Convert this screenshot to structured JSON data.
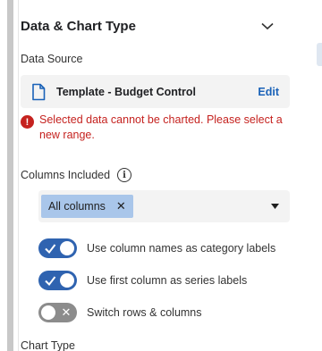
{
  "section": {
    "title": "Data & Chart Type",
    "collapse_icon": "chevron-up-icon"
  },
  "data_source": {
    "label": "Data Source",
    "icon": "document-icon",
    "name": "Template - Budget Control",
    "edit_label": "Edit"
  },
  "error": {
    "icon": "error-icon",
    "message": "Selected data cannot be charted. Please select a new range."
  },
  "columns": {
    "label": "Columns Included",
    "info_icon": "info-icon",
    "selected_chip": "All columns",
    "remove_icon": "close-icon",
    "dropdown_icon": "caret-down-icon"
  },
  "toggles": [
    {
      "label": "Use column names as category labels",
      "on": true
    },
    {
      "label": "Use first column as series labels",
      "on": true
    },
    {
      "label": "Switch rows & columns",
      "on": false
    }
  ],
  "chart_type": {
    "label": "Chart Type"
  },
  "colors": {
    "accent": "#2f63b0",
    "link": "#1a62b8",
    "error": "#c5221f",
    "chip": "#a9c6ea",
    "toggle_off": "#8c8c8c"
  }
}
